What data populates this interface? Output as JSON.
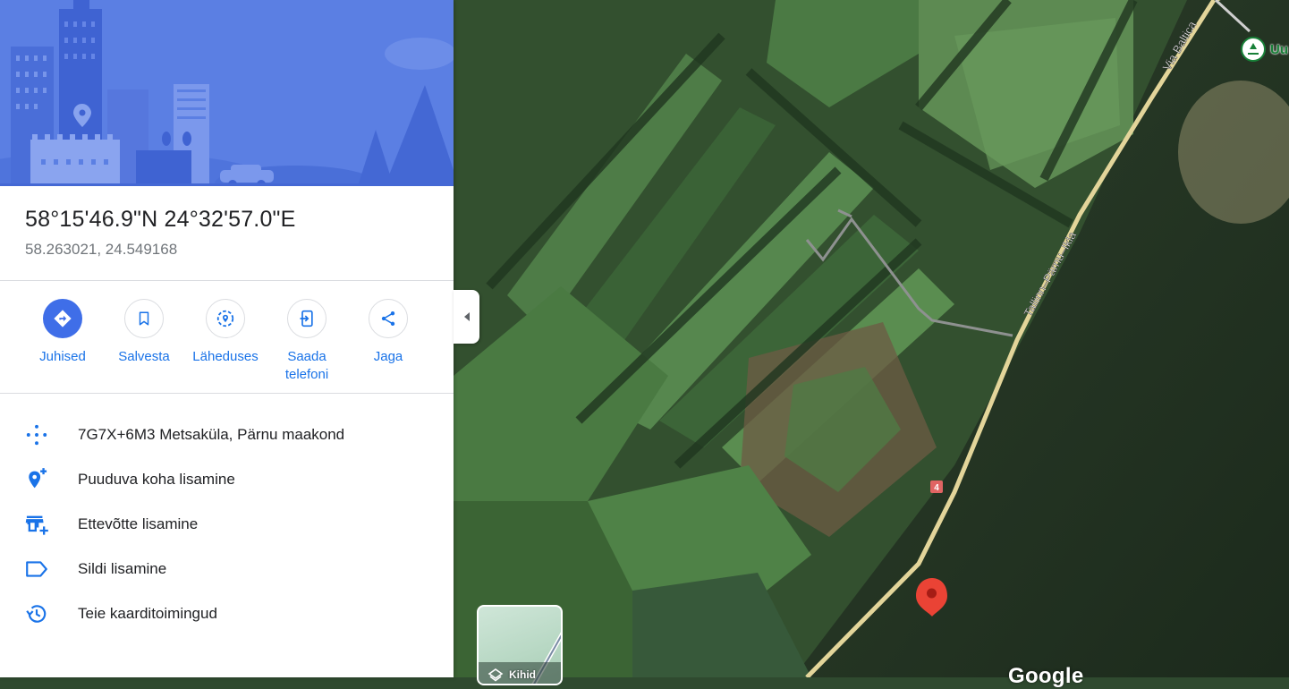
{
  "place": {
    "title": "58°15'46.9\"N 24°32'57.0\"E",
    "decimal": "58.263021, 24.549168"
  },
  "actions": [
    {
      "label": "Juhised",
      "icon": "directions-icon"
    },
    {
      "label": "Salvesta",
      "icon": "bookmark-icon"
    },
    {
      "label": "Läheduses",
      "icon": "nearby-icon"
    },
    {
      "label": "Saada telefoni",
      "icon": "send-to-phone-icon"
    },
    {
      "label": "Jaga",
      "icon": "share-icon"
    }
  ],
  "details": [
    {
      "label": "7G7X+6M3 Metsaküla, Pärnu maakond",
      "icon": "plus-code-icon"
    },
    {
      "label": "Puuduva koha lisamine",
      "icon": "add-place-icon"
    },
    {
      "label": "Ettevõtte lisamine",
      "icon": "add-business-icon"
    },
    {
      "label": "Sildi lisamine",
      "icon": "label-icon"
    },
    {
      "label": "Teie kaarditoimingud",
      "icon": "history-icon"
    }
  ],
  "map": {
    "road_labels": [
      "Via Baltica",
      "Tallinn–Pärnu–Ikla"
    ],
    "road_number": "4",
    "poi_label": "Uu",
    "layers_label": "Kihid",
    "google_label": "Google"
  },
  "colors": {
    "accent": "#1a73e8",
    "primary_button": "#3f6ee8",
    "hero_blue": "#5b7fe3",
    "pin_red": "#ea4335",
    "road_yellow": "#e3d59a"
  }
}
